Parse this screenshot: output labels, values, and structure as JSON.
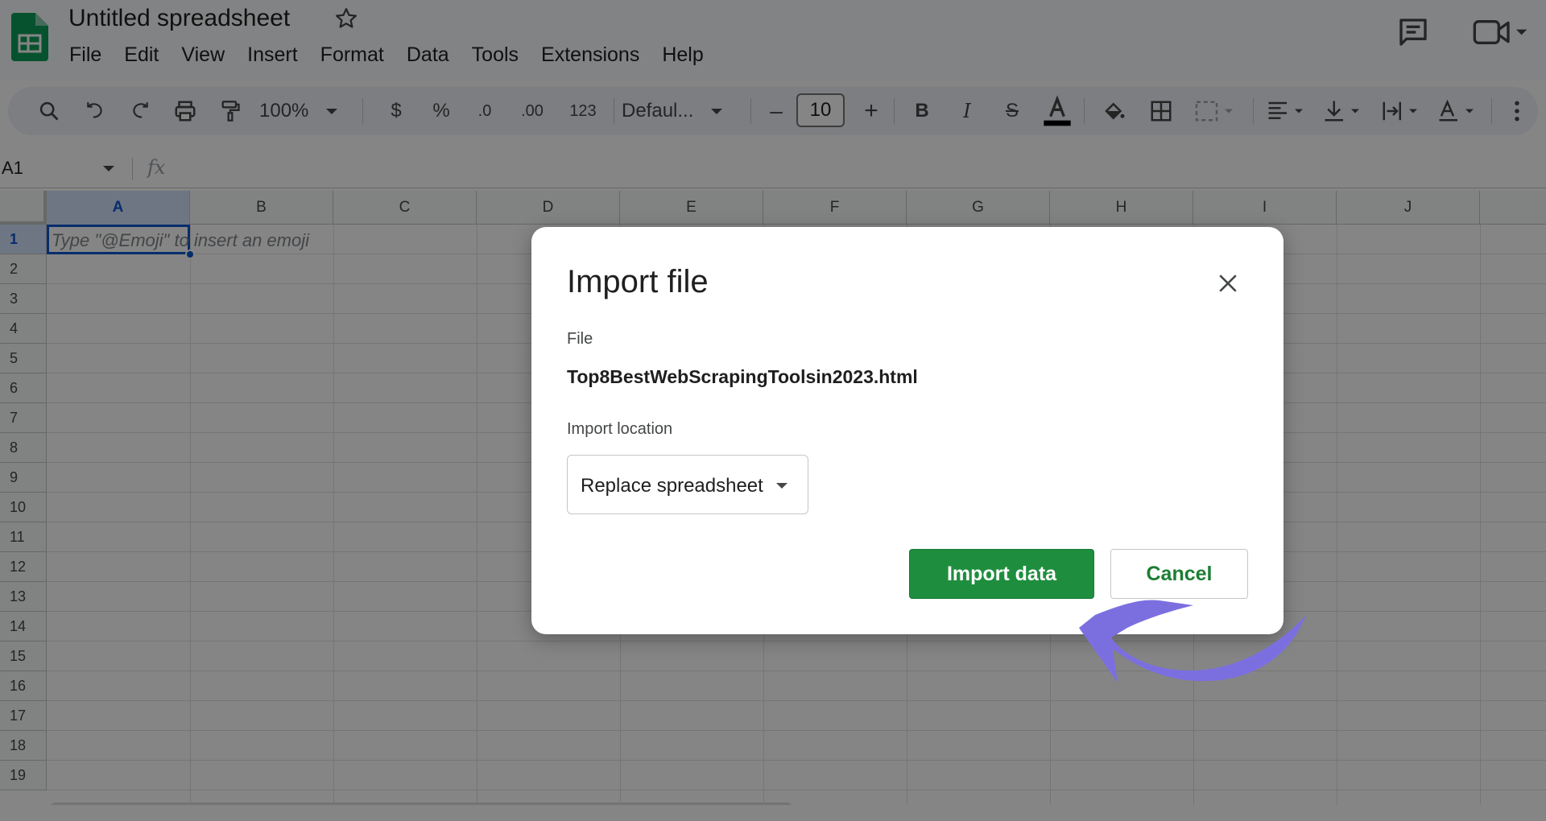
{
  "app": {
    "title": "Untitled spreadsheet",
    "menu": [
      "File",
      "Edit",
      "View",
      "Insert",
      "Format",
      "Data",
      "Tools",
      "Extensions",
      "Help"
    ]
  },
  "toolbar": {
    "zoom": "100%",
    "currency": "$",
    "percent": "%",
    "decrease_decimal": ".0",
    "increase_decimal": ".00",
    "number_format": "123",
    "font": "Defaul...",
    "font_size": "10",
    "minus": "–",
    "plus": "+"
  },
  "formula_bar": {
    "cell_ref": "A1",
    "fx": "fx"
  },
  "grid": {
    "columns": [
      "A",
      "B",
      "C",
      "D",
      "E",
      "F",
      "G",
      "H",
      "I",
      "J"
    ],
    "rows": [
      "1",
      "2",
      "3",
      "4",
      "5",
      "6",
      "7",
      "8",
      "9",
      "10",
      "11",
      "12",
      "13",
      "14",
      "15",
      "16",
      "17",
      "18",
      "19"
    ],
    "a1_hint": "Type \"@Emoji\" to insert an emoji"
  },
  "dialog": {
    "title": "Import file",
    "file_label": "File",
    "file_name": "Top8BestWebScrapingToolsin2023.html",
    "location_label": "Import location",
    "location_value": "Replace spreadsheet",
    "import_button": "Import data",
    "cancel_button": "Cancel"
  },
  "colors": {
    "sheets_green": "#0f9d58",
    "import_button": "#1e8e3e",
    "selection_blue": "#0b57d0",
    "annotation_arrow": "#7b6fe0"
  },
  "icons": [
    "sheets-logo",
    "star-icon",
    "comment-icon",
    "video-call-icon",
    "search-icon",
    "undo-icon",
    "redo-icon",
    "print-icon",
    "paint-format-icon",
    "bold-icon",
    "italic-icon",
    "strikethrough-icon",
    "text-color-icon",
    "fill-color-icon",
    "borders-icon",
    "merge-cells-icon",
    "align-left-icon",
    "valign-bottom-icon",
    "text-wrap-icon",
    "text-rotation-icon",
    "more-vert-icon",
    "close-icon"
  ]
}
